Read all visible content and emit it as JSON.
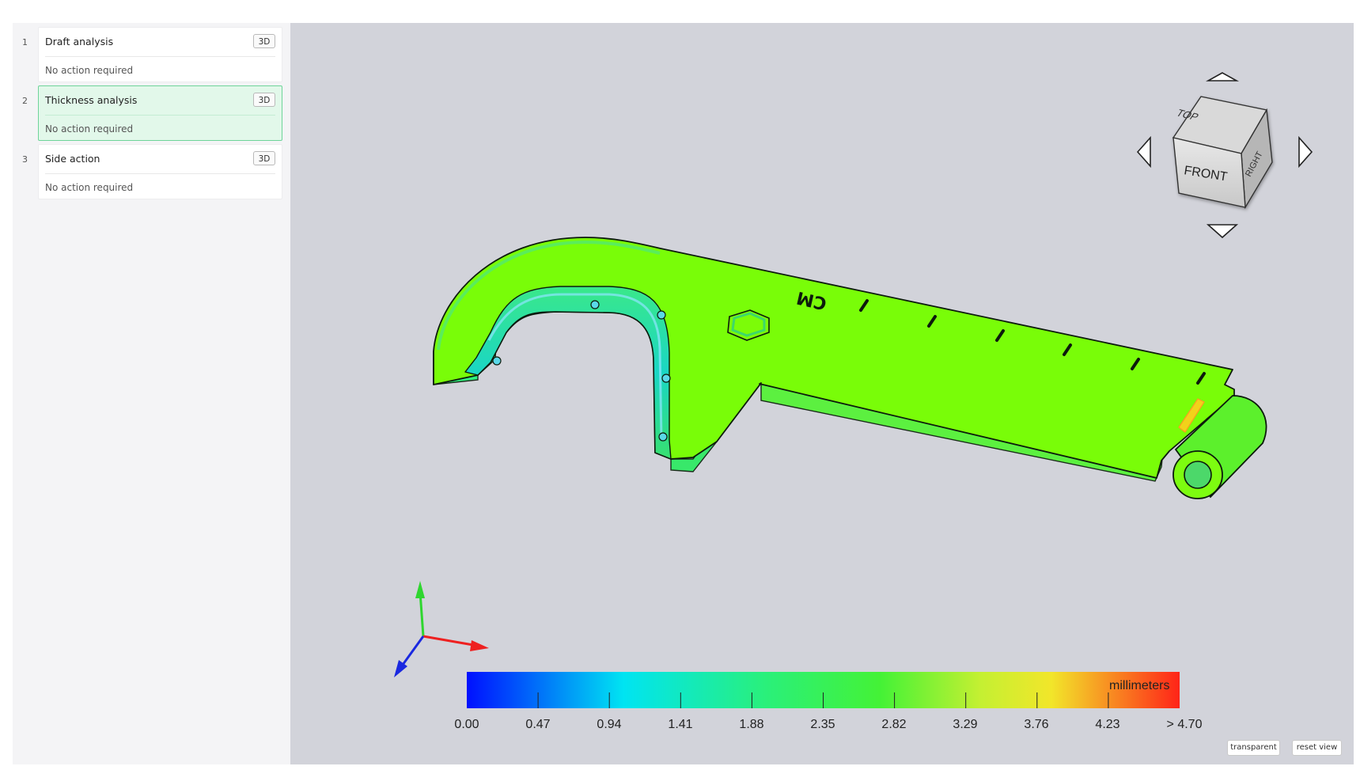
{
  "steps": [
    {
      "number": "1",
      "title": "Draft analysis",
      "badge": "3D",
      "status": "No action required"
    },
    {
      "number": "2",
      "title": "Thickness analysis",
      "badge": "3D",
      "status": "No action required"
    },
    {
      "number": "3",
      "title": "Side action",
      "badge": "3D",
      "status": "No action required"
    }
  ],
  "active_step": 2,
  "view_cube": {
    "top": "TOP",
    "front": "FRONT",
    "right": "RIGHT"
  },
  "part": {
    "engraving": "CM"
  },
  "legend": {
    "units": "millimeters",
    "ticks": [
      "0.00",
      "0.47",
      "0.94",
      "1.41",
      "1.88",
      "2.35",
      "2.82",
      "3.29",
      "3.76",
      "4.23",
      "> 4.70"
    ],
    "colors": [
      "#0019ff",
      "#00e6f0",
      "#22ee44",
      "#eeee22",
      "#ff2a1a"
    ]
  },
  "view_buttons": {
    "transparent": "transparent",
    "reset": "reset view"
  },
  "colors": {
    "active_step_bg": "#e2f8ea",
    "active_step_border": "#6fd49a",
    "viewport_bg": "#d2d3da",
    "part_surface": "#7dff0a"
  }
}
